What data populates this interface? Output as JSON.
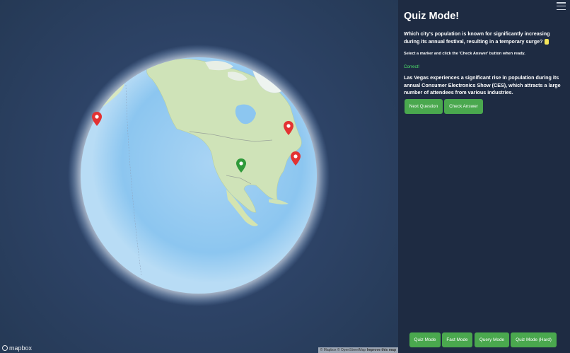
{
  "map": {
    "logo_text": "mapbox",
    "attribution": {
      "prefix": "© Mapbox © OpenStreetMap",
      "improve_link": "Improve this map"
    },
    "markers": [
      {
        "name": "marker-1",
        "color": "#e33232"
      },
      {
        "name": "marker-2",
        "color": "#e33232"
      },
      {
        "name": "marker-3",
        "color": "#e33232"
      },
      {
        "name": "marker-4",
        "color": "#2f9a3a"
      }
    ]
  },
  "panel": {
    "menu_icon": "hamburger-menu-icon",
    "title": "Quiz Mode!",
    "question": "Which city's population is known for significantly increasing during its annual festival, resulting in a temporary surge?",
    "instruction": "Select a marker and click the 'Check Answer' button when ready.",
    "feedback": "Correct!",
    "explanation": "Las Vegas experiences a significant rise in population during its annual Consumer Electronics Show (CES), which attracts a large number of attendees from various industries.",
    "buttons": {
      "next": "Next Question",
      "check": "Check Answer"
    },
    "modes": {
      "quiz": "Quiz Mode",
      "fact": "Fact Mode",
      "query": "Query Mode",
      "quiz_hard": "Quiz Mode (Hard)"
    }
  },
  "colors": {
    "panel_bg": "#1e2b42",
    "button_bg": "#4aa84e",
    "correct_text": "#4ee06a",
    "highlight": "#f5e65a"
  }
}
